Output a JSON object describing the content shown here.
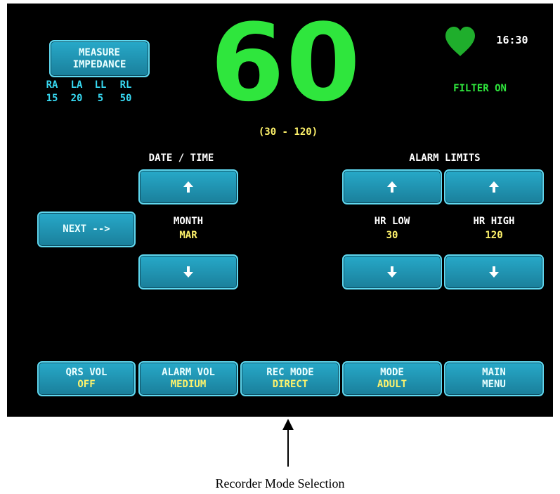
{
  "impedance": {
    "button_label": [
      "MEASURE",
      "IMPEDANCE"
    ],
    "leads": [
      {
        "name": "RA",
        "value": "15"
      },
      {
        "name": "LA",
        "value": "20"
      },
      {
        "name": "LL",
        "value": "5"
      },
      {
        "name": "RL",
        "value": "50"
      }
    ]
  },
  "heart_rate": {
    "value": "60",
    "range": "(30 - 120)"
  },
  "status": {
    "time": "16:30",
    "filter": "FILTER ON",
    "heart_icon": "heart-icon"
  },
  "date_time": {
    "title": "DATE / TIME",
    "field": "MONTH",
    "value": "MAR",
    "next_label": "NEXT -->"
  },
  "alarm_limits": {
    "title": "ALARM LIMITS",
    "low_label": "HR LOW",
    "low_value": "30",
    "high_label": "HR HIGH",
    "high_value": "120"
  },
  "bottom_menu": [
    {
      "label": "QRS VOL",
      "value": "OFF"
    },
    {
      "label": "ALARM VOL",
      "value": "MEDIUM"
    },
    {
      "label": "REC MODE",
      "value": "DIRECT"
    },
    {
      "label": "MODE",
      "value": "ADULT"
    },
    {
      "label": "MAIN",
      "value": "MENU"
    }
  ],
  "caption": "Recorder Mode Selection",
  "colors": {
    "screen": "#000000",
    "button": "#1a7f9b",
    "accent_green": "#2fe63d",
    "label_cyan": "#37d9f2",
    "value_yellow": "#fff36b"
  }
}
